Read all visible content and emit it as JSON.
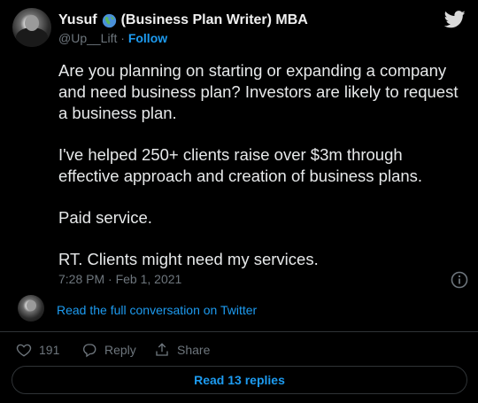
{
  "author": {
    "name_prefix": "Yusuf",
    "name_suffix": "(Business Plan Writer) MBA",
    "handle": "@Up__Lift",
    "separator": "·",
    "follow_label": "Follow"
  },
  "tweet": {
    "paragraphs": [
      "Are you planning on starting or expanding a company and need business plan? Investors are likely to request a business plan.",
      "I've helped 250+ clients raise over $3m through effective approach and creation of business plans.",
      "Paid service.",
      "RT. Clients might need my services."
    ],
    "timestamp": "7:28 PM · Feb 1, 2021"
  },
  "conversation": {
    "link_label": "Read the full conversation on Twitter"
  },
  "actions": {
    "like_count": "191",
    "reply_label": "Reply",
    "share_label": "Share"
  },
  "footer": {
    "read_replies_label": "Read 13 replies"
  },
  "colors": {
    "background": "#000000",
    "accent": "#1d9bf0",
    "muted": "#6e767d",
    "text": "#e7e9ea",
    "border": "#2f3336"
  },
  "icons": [
    "globe-emoji-icon",
    "twitter-bird-icon",
    "info-icon",
    "heart-icon",
    "reply-icon",
    "share-icon"
  ]
}
